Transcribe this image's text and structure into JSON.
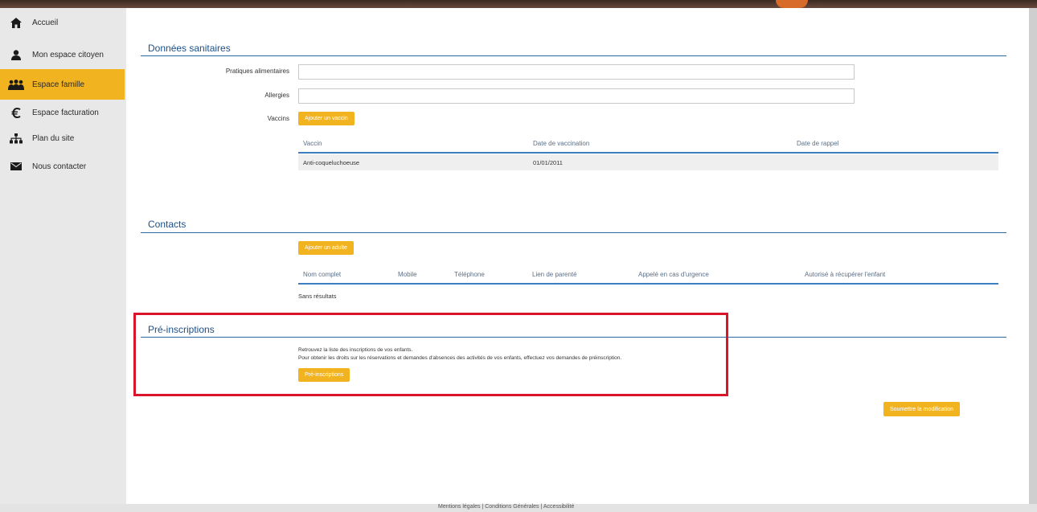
{
  "sidebar": {
    "items": [
      {
        "label": "Accueil",
        "icon": "home-icon"
      },
      {
        "label": "Mon espace citoyen",
        "icon": "user-icon"
      },
      {
        "label": "Espace famille",
        "icon": "family-icon",
        "active": true
      },
      {
        "label": "Espace facturation",
        "icon": "euro-icon"
      },
      {
        "label": "Plan du site",
        "icon": "sitemap-icon"
      },
      {
        "label": "Nous contacter",
        "icon": "envelope-icon"
      }
    ]
  },
  "sanitary": {
    "title": "Données sanitaires",
    "food_label": "Pratiques alimentaires",
    "food_value": "",
    "allergies_label": "Allergies",
    "allergies_value": "",
    "vaccines_label": "Vaccins",
    "add_vaccine_button": "Ajouter un vaccin",
    "table": {
      "headers": [
        "Vaccin",
        "Date de vaccination",
        "Date de rappel"
      ],
      "rows": [
        [
          "Anti-coqueluchoeuse",
          "01/01/2011",
          ""
        ]
      ]
    }
  },
  "contacts": {
    "title": "Contacts",
    "add_adult_button": "Ajouter un adulte",
    "headers": [
      "Nom complet",
      "Mobile",
      "Téléphone",
      "Lien de parenté",
      "Appelé en cas d'urgence",
      "Autorisé à récupérer l'enfant"
    ],
    "empty_text": "Sans résultats"
  },
  "preinscriptions": {
    "title": "Pré-inscriptions",
    "line1": "Retrouvez la liste des inscriptions de vos enfants.",
    "line2": "Pour obtenir les droits sur les réservations et demandes d'absences des activités de vos enfants, effectuez vos demandes de préinscription.",
    "button": "Pré-inscriptions"
  },
  "submit_button": "Soumettre la modification",
  "footer": {
    "text": "Mentions légales | Conditions Générales | Accessibilité"
  },
  "colors": {
    "accent": "#f2b321",
    "section_title": "#1c4f86",
    "highlight": "#d9142b"
  }
}
